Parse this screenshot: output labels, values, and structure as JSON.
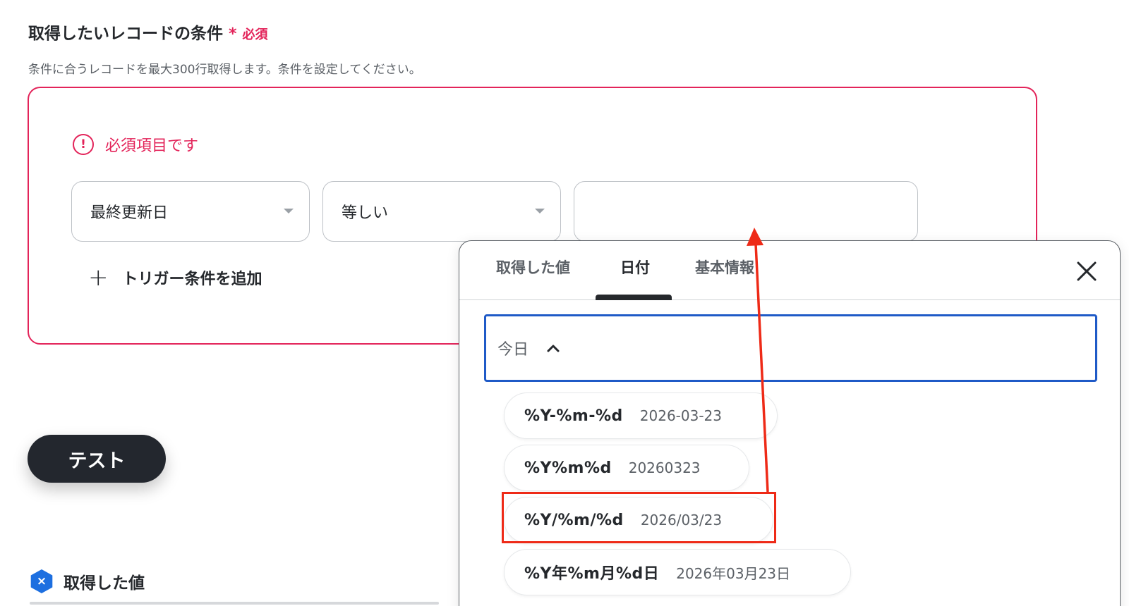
{
  "section": {
    "title": "取得したいレコードの条件",
    "required_mark": "*",
    "required_text": "必須",
    "description": "条件に合うレコードを最大300行取得します。条件を設定してください。"
  },
  "conditions": {
    "error_text": "必須項目です",
    "field_select": "最終更新日",
    "operator_select": "等しい",
    "value_input": "",
    "add_trigger_label": "トリガー条件を追加"
  },
  "test_button_label": "テスト",
  "acquired": {
    "title": "取得した値"
  },
  "popover": {
    "tabs": [
      {
        "label": "取得した値"
      },
      {
        "label": "日付"
      },
      {
        "label": "基本情報"
      }
    ],
    "active_tab": "日付",
    "search_value": "今日",
    "options": [
      {
        "format": "%Y-%m-%d",
        "example": "2026-03-23"
      },
      {
        "format": "%Y%m%d",
        "example": "20260323"
      },
      {
        "format": "%Y/%m/%d",
        "example": "2026/03/23"
      },
      {
        "format": "%Y年%m月%d日",
        "example": "2026年03月23日"
      }
    ],
    "highlighted_option": "%Y/%m/%d"
  },
  "colors": {
    "required_red": "#e3245a",
    "annotation_red": "#ee2a17",
    "focus_blue": "#1f5ac7",
    "dark_button": "#23272e"
  },
  "icons": {
    "error": "exclamation-circle-icon",
    "add": "plus-icon",
    "close": "close-icon",
    "collapse": "chevron-up-icon",
    "acquired": "variable-hexagon-icon"
  }
}
